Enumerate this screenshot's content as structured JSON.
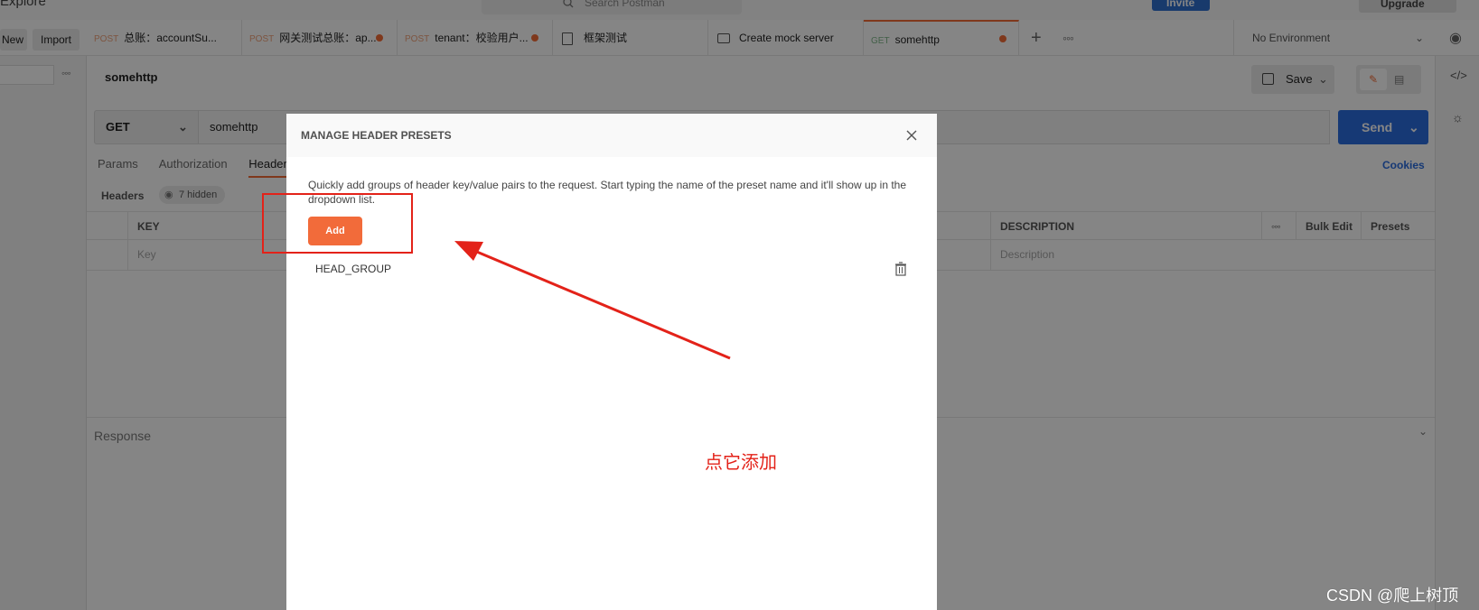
{
  "topbar": {
    "explore_label": "Explore",
    "search_placeholder": "Search Postman",
    "invite_label": "Invite",
    "upgrade_label": "Upgrade"
  },
  "tabbar": {
    "new_label": "New",
    "import_label": "Import",
    "tabs": [
      {
        "method": "POST",
        "title": "总账：accountSu..."
      },
      {
        "method": "POST",
        "title": "网关测试总账：ap..."
      },
      {
        "method": "POST",
        "title": "tenant：校验用户..."
      },
      {
        "method": "",
        "title": "框架测试"
      },
      {
        "method": "",
        "title": "Create mock server"
      },
      {
        "method": "GET",
        "title": "somehttp"
      }
    ],
    "environment": "No Environment"
  },
  "request": {
    "title": "somehttp",
    "save_label": "Save",
    "method": "GET",
    "url": "somehttp",
    "send_label": "Send",
    "tabs": [
      "Params",
      "Authorization",
      "Header"
    ],
    "cookies_label": "Cookies",
    "headers_label": "Headers",
    "hidden_label": "7 hidden",
    "table": {
      "key_header": "KEY",
      "description_header": "DESCRIPTION",
      "bulk_edit_label": "Bulk Edit",
      "presets_label": "Presets",
      "key_placeholder": "Key",
      "description_placeholder": "Description"
    },
    "response_label": "Response"
  },
  "modal": {
    "title": "MANAGE HEADER PRESETS",
    "description": "Quickly add groups of header key/value pairs to the request. Start typing the name of the preset name and it'll show up in the dropdown list.",
    "add_label": "Add",
    "presets": [
      {
        "name": "HEAD_GROUP"
      }
    ]
  },
  "annotation": {
    "text": "点它添加",
    "color": "#e32219"
  },
  "watermark": "CSDN @爬上树顶",
  "colors": {
    "accent": "#f26b3a",
    "primary": "#2b6de0"
  }
}
